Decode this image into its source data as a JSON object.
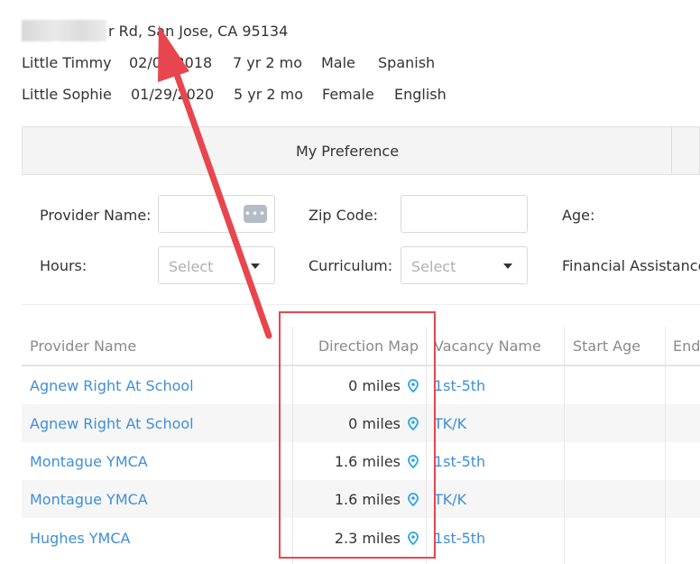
{
  "header": {
    "address_suffix": "r Rd, San Jose, CA 95134",
    "children": [
      {
        "name": "Little Timmy",
        "dob": "02/01/2018",
        "age": "7 yr 2 mo",
        "gender": "Male",
        "language": "Spanish"
      },
      {
        "name": "Little Sophie",
        "dob": "01/29/2020",
        "age": "5 yr 2 mo",
        "gender": "Female",
        "language": "English"
      }
    ]
  },
  "tabs": {
    "my_preference": "My Preference"
  },
  "filters": {
    "provider_name_label": "Provider Name:",
    "zip_code_label": "Zip Code:",
    "age_label": "Age:",
    "hours_label": "Hours:",
    "hours_placeholder": "Select",
    "curriculum_label": "Curriculum:",
    "curriculum_placeholder": "Select",
    "financial_label": "Financial Assistance:"
  },
  "table": {
    "columns": [
      "Provider Name",
      "Direction Map",
      "Vacancy Name",
      "Start Age",
      "End"
    ],
    "rows": [
      {
        "provider": "Agnew Right At School",
        "distance": "0 miles",
        "vacancy": "1st-5th"
      },
      {
        "provider": "Agnew Right At School",
        "distance": "0 miles",
        "vacancy": "TK/K"
      },
      {
        "provider": "Montague YMCA",
        "distance": "1.6 miles",
        "vacancy": "1st-5th"
      },
      {
        "provider": "Montague YMCA",
        "distance": "1.6 miles",
        "vacancy": "TK/K"
      },
      {
        "provider": "Hughes YMCA",
        "distance": "2.3 miles",
        "vacancy": "1st-5th"
      }
    ]
  },
  "colors": {
    "link": "#3f8fd8",
    "pin": "#2aa7e0",
    "annotation": "#e8464e"
  }
}
